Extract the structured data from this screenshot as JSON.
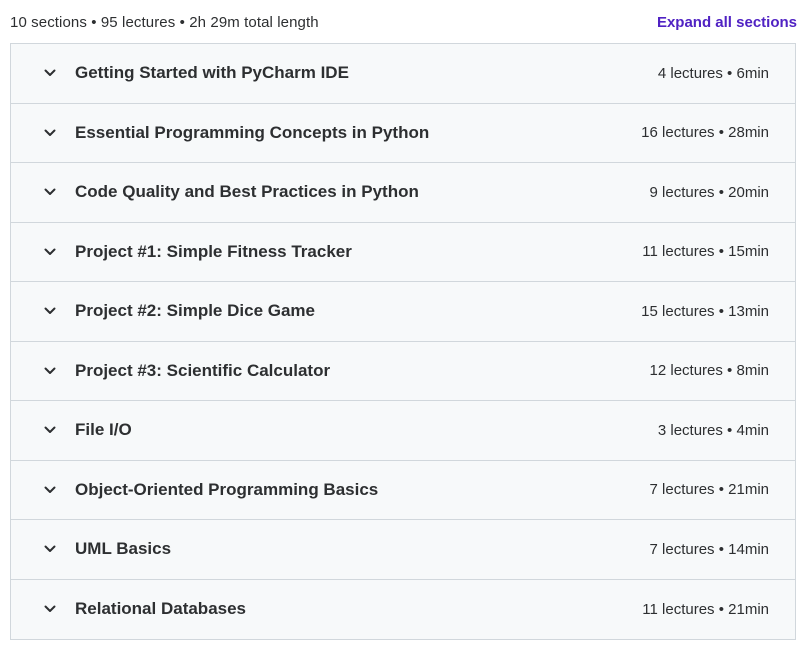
{
  "curriculum": {
    "summary": "10 sections • 95 lectures • 2h 29m total length",
    "expand_all_label": "Expand all sections",
    "sections": [
      {
        "title": "Getting Started with PyCharm IDE",
        "meta": "4 lectures • 6min"
      },
      {
        "title": "Essential Programming Concepts in Python",
        "meta": "16 lectures • 28min"
      },
      {
        "title": "Code Quality and Best Practices in Python",
        "meta": "9 lectures • 20min"
      },
      {
        "title": "Project #1: Simple Fitness Tracker",
        "meta": "11 lectures • 15min"
      },
      {
        "title": "Project #2: Simple Dice Game",
        "meta": "15 lectures • 13min"
      },
      {
        "title": "Project #3: Scientific Calculator",
        "meta": "12 lectures • 8min"
      },
      {
        "title": "File I/O",
        "meta": "3 lectures • 4min"
      },
      {
        "title": "Object-Oriented Programming Basics",
        "meta": "7 lectures • 21min"
      },
      {
        "title": "UML Basics",
        "meta": "7 lectures • 14min"
      },
      {
        "title": "Relational Databases",
        "meta": "11 lectures • 21min"
      }
    ],
    "section_icon": "chevron-down-icon",
    "colors": {
      "link": "#5022c3",
      "text": "#2d2f31",
      "section_bg": "#f7f9fa",
      "border": "#d1d7dc"
    }
  }
}
